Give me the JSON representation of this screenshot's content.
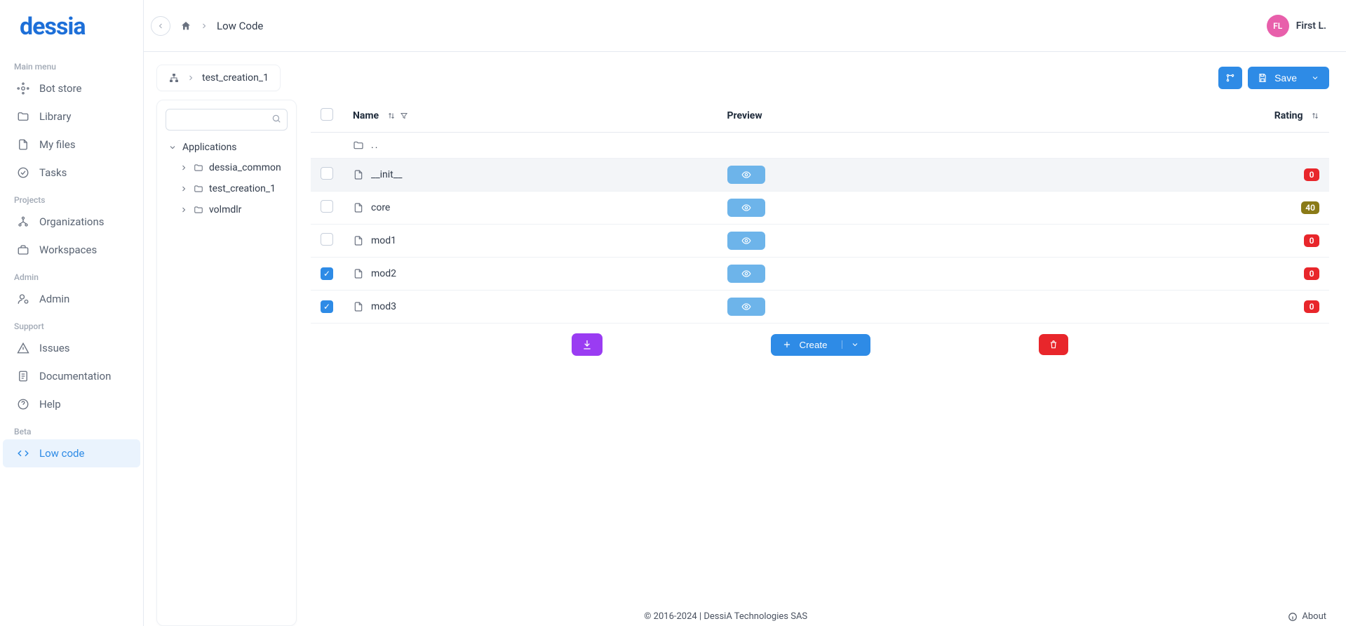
{
  "logo": "dessia",
  "topbar": {
    "breadcrumb_current": "Low Code",
    "user_initials": "FL",
    "user_name": "First L."
  },
  "sidebar": {
    "sections": {
      "main": "Main menu",
      "projects": "Projects",
      "admin": "Admin",
      "support": "Support",
      "beta": "Beta"
    },
    "items": {
      "bot_store": "Bot store",
      "library": "Library",
      "my_files": "My files",
      "tasks": "Tasks",
      "orgs": "Organizations",
      "workspaces": "Workspaces",
      "admin": "Admin",
      "issues": "Issues",
      "docs": "Documentation",
      "help": "Help",
      "low_code": "Low code"
    }
  },
  "subheader": {
    "crumb": "test_creation_1",
    "save_label": "Save"
  },
  "tree": {
    "root": "Applications",
    "nodes": [
      "dessia_common",
      "test_creation_1",
      "volmdlr"
    ]
  },
  "table": {
    "headers": {
      "name": "Name",
      "preview": "Preview",
      "rating": "Rating"
    },
    "parent_row": "..",
    "rows": [
      {
        "name": "__init__",
        "checked": false,
        "rating": 0,
        "rating_class": "rating-red"
      },
      {
        "name": "core",
        "checked": false,
        "rating": 40,
        "rating_class": "rating-olive"
      },
      {
        "name": "mod1",
        "checked": false,
        "rating": 0,
        "rating_class": "rating-red"
      },
      {
        "name": "mod2",
        "checked": true,
        "rating": 0,
        "rating_class": "rating-red"
      },
      {
        "name": "mod3",
        "checked": true,
        "rating": 0,
        "rating_class": "rating-red"
      }
    ]
  },
  "actions": {
    "create": "Create"
  },
  "footer": {
    "copyright": "© 2016-2024 | DessiA Technologies SAS",
    "about": "About"
  }
}
